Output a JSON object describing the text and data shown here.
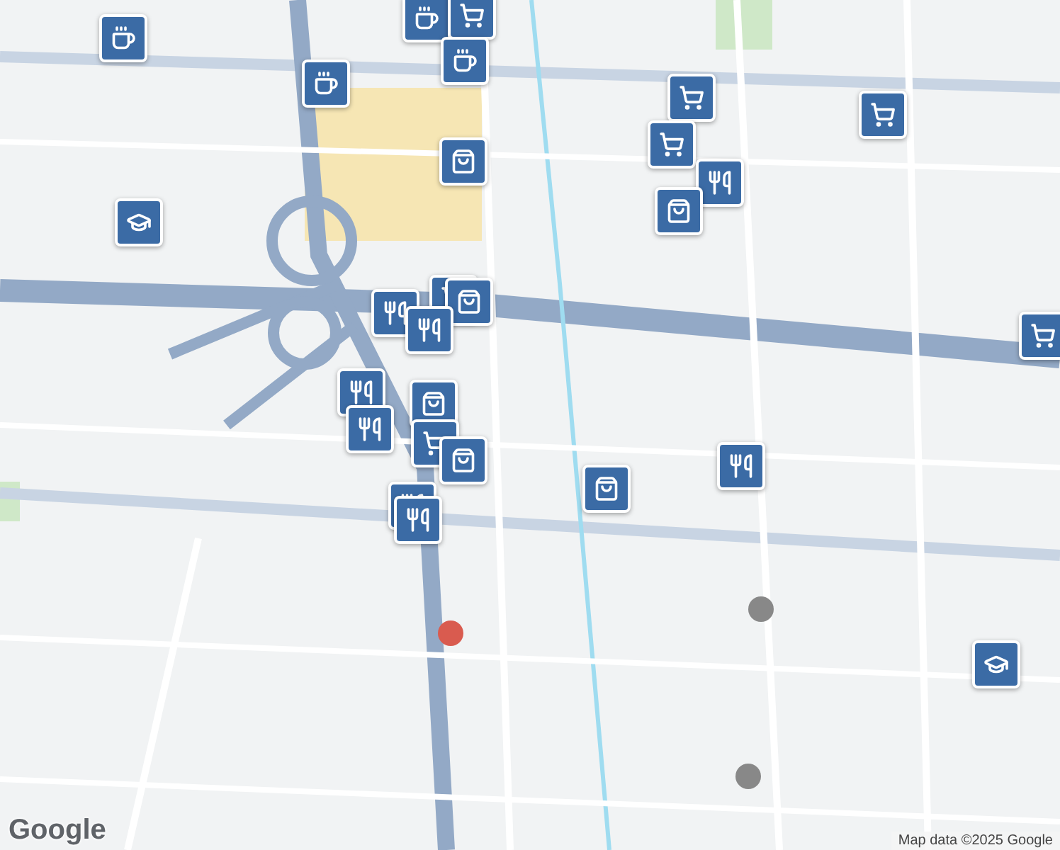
{
  "map": {
    "markers": [
      {
        "kind": "coffee"
      },
      {
        "kind": "coffee"
      },
      {
        "kind": "coffee"
      },
      {
        "kind": "cart"
      },
      {
        "kind": "coffee"
      },
      {
        "kind": "cart"
      },
      {
        "kind": "cart"
      },
      {
        "kind": "cart"
      },
      {
        "kind": "bag"
      },
      {
        "kind": "restaurant"
      },
      {
        "kind": "bag"
      },
      {
        "kind": "school"
      },
      {
        "kind": "cart"
      },
      {
        "kind": "bag"
      },
      {
        "kind": "restaurant"
      },
      {
        "kind": "restaurant"
      },
      {
        "kind": "cart"
      },
      {
        "kind": "restaurant"
      },
      {
        "kind": "bag"
      },
      {
        "kind": "restaurant"
      },
      {
        "kind": "cart"
      },
      {
        "kind": "bag"
      },
      {
        "kind": "bag"
      },
      {
        "kind": "restaurant"
      },
      {
        "kind": "restaurant"
      },
      {
        "kind": "restaurant"
      },
      {
        "kind": "school"
      }
    ]
  },
  "attribution": {
    "logo": "Google",
    "text": "Map data ©2025 Google"
  }
}
